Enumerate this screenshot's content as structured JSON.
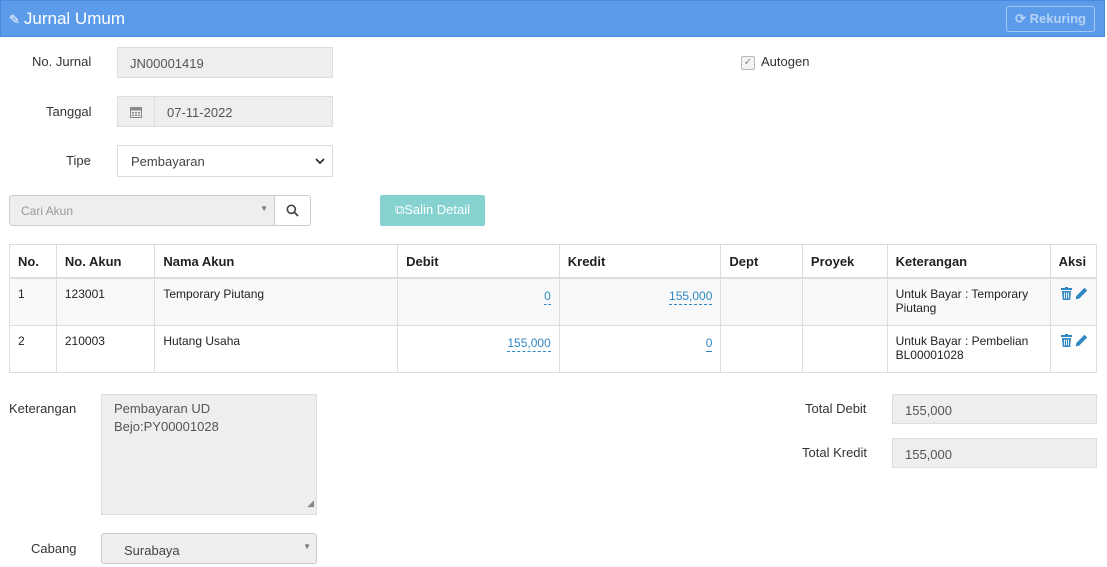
{
  "header": {
    "title": "Jurnal Umum",
    "rekuring_label": "Rekuring"
  },
  "form": {
    "no_jurnal_label": "No. Jurnal",
    "no_jurnal_value": "JN00001419",
    "autogen_label": "Autogen",
    "autogen_checked": true,
    "tanggal_label": "Tanggal",
    "tanggal_value": "07-11-2022",
    "tipe_label": "Tipe",
    "tipe_value": "Pembayaran",
    "cari_akun_placeholder": "Cari Akun",
    "salin_detail_label": "Salin Detail"
  },
  "table": {
    "columns": [
      "No.",
      "No. Akun",
      "Nama Akun",
      "Debit",
      "Kredit",
      "Dept",
      "Proyek",
      "Keterangan",
      "Aksi"
    ],
    "rows": [
      {
        "no": "1",
        "no_akun": "123001",
        "nama_akun": "Temporary Piutang",
        "debit": "0",
        "kredit": "155,000",
        "dept": "",
        "proyek": "",
        "keterangan": "Untuk Bayar : Temporary Piutang"
      },
      {
        "no": "2",
        "no_akun": "210003",
        "nama_akun": "Hutang Usaha",
        "debit": "155,000",
        "kredit": "0",
        "dept": "",
        "proyek": "",
        "keterangan": "Untuk Bayar : Pembelian BL00001028"
      }
    ]
  },
  "footer": {
    "keterangan_label": "Keterangan",
    "keterangan_value": "Pembayaran UD\nBejo:PY00001028",
    "total_debit_label": "Total Debit",
    "total_debit_value": "155,000",
    "total_kredit_label": "Total Kredit",
    "total_kredit_value": "155,000",
    "cabang_label": "Cabang",
    "cabang_value": "Surabaya"
  },
  "colors": {
    "header_bg": "#5b9bea",
    "link": "#2f87c3",
    "salin_btn": "#85d2d0",
    "table_border": "#3aa7b3"
  }
}
